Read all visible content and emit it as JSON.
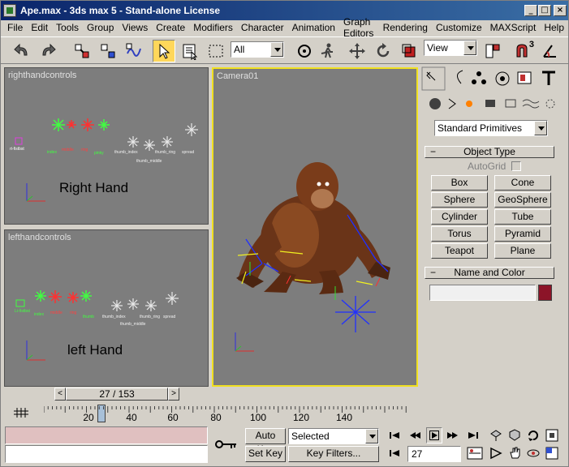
{
  "window": {
    "title": "Ape.max - 3ds max 5 - Stand-alone License",
    "minimize": "_",
    "maximize": "□",
    "close": "×"
  },
  "menu": [
    "File",
    "Edit",
    "Tools",
    "Group",
    "Views",
    "Create",
    "Modifiers",
    "Character",
    "Animation",
    "Graph Editors",
    "Rendering",
    "Customize",
    "MAXScript",
    "Help"
  ],
  "toolbar": {
    "selection_filter": "All",
    "ref_coord": "View",
    "snap_number": "3"
  },
  "viewports": {
    "top_left": {
      "label": "righthandcontrols",
      "caption": "Right Hand",
      "labels": [
        "rt-fistbst",
        "index",
        "middle",
        "ring",
        "pinky",
        "thumb_index",
        "thumb_middle",
        "thumb_ring",
        "spread"
      ]
    },
    "bottom_left": {
      "label": "lefthandcontrols",
      "caption": "left Hand",
      "labels": [
        "Lt-fistbst",
        "index",
        "middle",
        "ring",
        "thumb",
        "thumb_index",
        "thumb_middle",
        "thumb_ring",
        "spread"
      ]
    },
    "camera": {
      "label": "Camera01"
    }
  },
  "command_panel": {
    "category": "Standard Primitives",
    "object_type": {
      "title": "Object Type",
      "autogrid": "AutoGrid",
      "buttons": [
        "Box",
        "Cone",
        "Sphere",
        "GeoSphere",
        "Cylinder",
        "Tube",
        "Torus",
        "Pyramid",
        "Teapot",
        "Plane"
      ]
    },
    "name_color": {
      "title": "Name and Color",
      "name_value": "",
      "color": "#8c1428"
    }
  },
  "time": {
    "slider_text": "27 / 153",
    "prev": "<",
    "next": ">",
    "ruler_labels": [
      "20",
      "40",
      "60",
      "80",
      "100",
      "120",
      "140"
    ],
    "current_frame": "27"
  },
  "bottom": {
    "auto_key": "Auto Key",
    "set_key": "Set Key",
    "selected": "Selected",
    "key_filters": "Key Filters..."
  },
  "colors": {
    "viewport_bg": "#7d7d7d",
    "active_border": "#f0e020",
    "title_bar": "#0a246a",
    "active_tool": "#ffd75a"
  }
}
